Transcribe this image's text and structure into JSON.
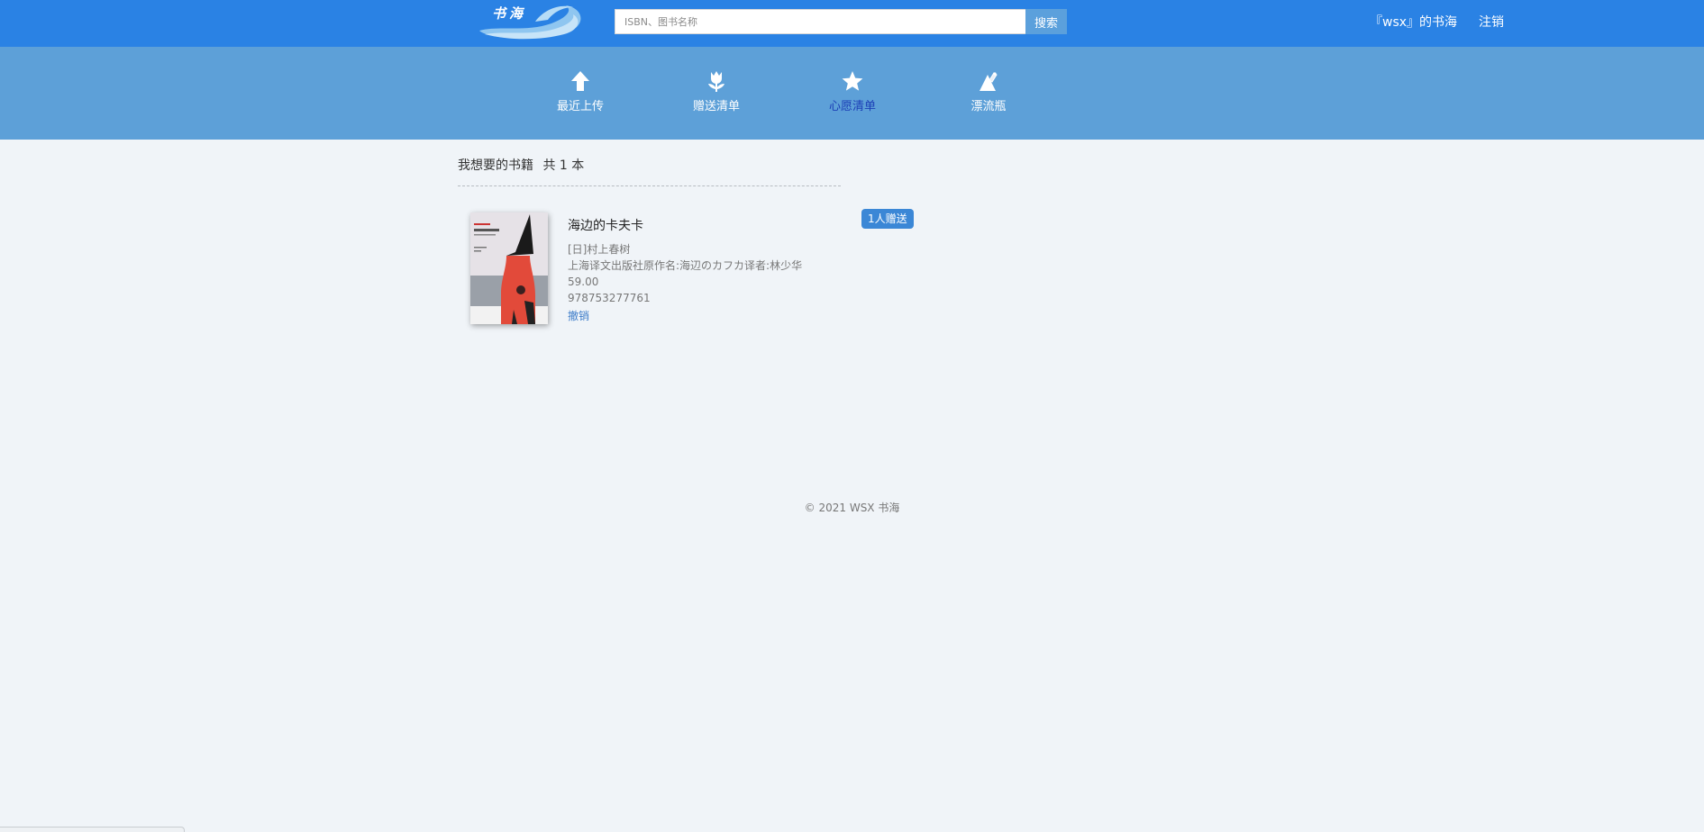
{
  "header": {
    "logo_text": "书海",
    "search": {
      "placeholder": "ISBN、图书名称",
      "value": "",
      "button_label": "搜索"
    },
    "user_link": "『wsx』的书海",
    "logout_label": "注销"
  },
  "nav": {
    "items": [
      {
        "label": "最近上传",
        "icon": "upload-arrow-icon"
      },
      {
        "label": "赠送清单",
        "icon": "tulip-icon"
      },
      {
        "label": "心愿清单",
        "icon": "star-icon",
        "active": true
      },
      {
        "label": "漂流瓶",
        "icon": "bottle-icon"
      }
    ],
    "active_color": "#1c3fb6"
  },
  "section": {
    "title": "我想要的书籍",
    "count_text": "共 1 本"
  },
  "books": [
    {
      "title": "海边的卡夫卡",
      "author": "[日]村上春树",
      "publisher_line": "上海译文出版社原作名:海辺のカフカ译者:林少华",
      "price": "59.00",
      "isbn": "978753277761",
      "action_label": "撤销",
      "badge": "1人赠送"
    }
  ],
  "footer": {
    "copyright": "© 2021 WSX 书海"
  },
  "colors": {
    "topbar": "#2a82e4",
    "navbar": "#5da0d8",
    "page_bg": "#f0f4f8",
    "badge": "#3b87d6",
    "link": "#3d7cc9"
  }
}
